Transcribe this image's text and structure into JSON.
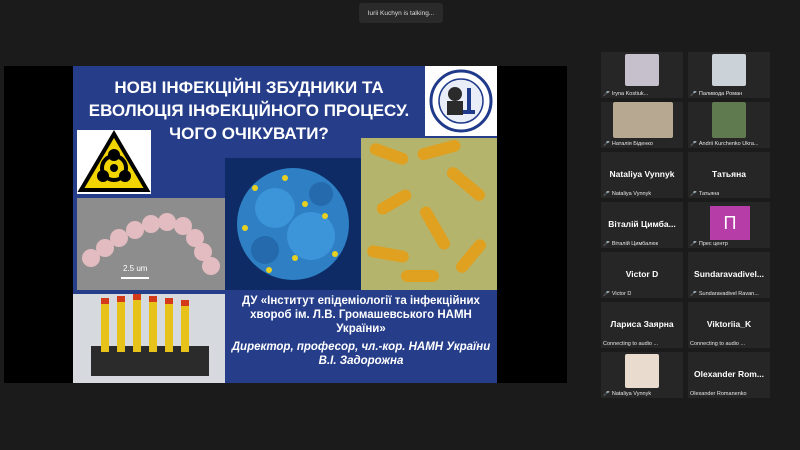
{
  "app": {
    "speaking": "Iurii Kuchyn is talking..."
  },
  "slide": {
    "title_lines": [
      "НОВІ  ІНФЕКЦІЙНІ ЗБУДНИКИ ТА",
      "ЕВОЛЮЦІЯ ІНФЕКЦІЙНОГО ПРОЦЕСУ.",
      "ЧОГО ОЧІКУВАТИ?"
    ],
    "scale_label": "2.5 um",
    "institute_lines": [
      "ДУ «Інститут епідеміології та інфекційних",
      "хвороб ім. Л.В. Громашевського НАМН",
      "України»"
    ],
    "role_lines": [
      "Директор, професор, чл.-кор. НАМН України",
      "В.І. Задорожна"
    ]
  },
  "participants": [
    {
      "name": "",
      "label": "Iryna Kostiuk...",
      "video": true
    },
    {
      "name": "",
      "label": "Паливода Роман",
      "video": true
    },
    {
      "name": "",
      "label": "Наталія Біденко",
      "video": true
    },
    {
      "name": "",
      "label": "Andrii Kurchenko Ukra...",
      "video": true
    },
    {
      "name": "Nataliya Vynnyk",
      "label": "Nataliya Vynnyk",
      "video": false
    },
    {
      "name": "Татьяна",
      "label": "Татьяна",
      "video": false
    },
    {
      "name": "Віталій Цимба...",
      "label": "Віталій Цимбалюк",
      "video": false
    },
    {
      "name": "П",
      "label": "Прес центр",
      "video": false
    },
    {
      "name": "Victor D",
      "label": "Victor D",
      "video": false
    },
    {
      "name": "Sundaravadivel...",
      "label": "Sundaravadivel Ravan...",
      "video": false
    },
    {
      "name": "Лариса Заярна",
      "label": "Connecting to audio ...",
      "video": false
    },
    {
      "name": "Viktoriia_K",
      "label": "Connecting to audio ...",
      "video": false
    },
    {
      "name": "",
      "label": "Nataliya Vynnyk",
      "video": true
    },
    {
      "name": "Olexander  Rom...",
      "label": "Olexander Romanenko",
      "video": false
    }
  ],
  "colors": {
    "slide_bg": "#263d8a",
    "avatar_p": "#b63ca8",
    "mic_muted": "#e22233"
  }
}
